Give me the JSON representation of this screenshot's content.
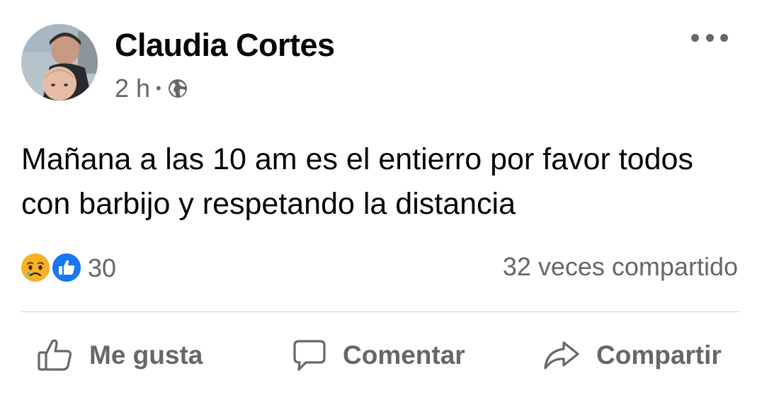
{
  "post": {
    "author": "Claudia Cortes",
    "time": "2 h",
    "separator": "•",
    "privacy_icon": "globe-icon",
    "text": "Mañana a las 10 am es el entierro por favor todos con barbijo y respetando la distancia"
  },
  "reactions": {
    "icons": [
      "sad-reaction-icon",
      "like-reaction-icon"
    ],
    "count": "30"
  },
  "shares": "32 veces compartido",
  "actions": {
    "like_label": "Me gusta",
    "comment_label": "Comentar",
    "share_label": "Compartir"
  },
  "colors": {
    "secondary_text": "#65676b",
    "like_blue": "#1877f2",
    "sad_yellow": "#f7b125",
    "divider": "#ced0d4"
  }
}
